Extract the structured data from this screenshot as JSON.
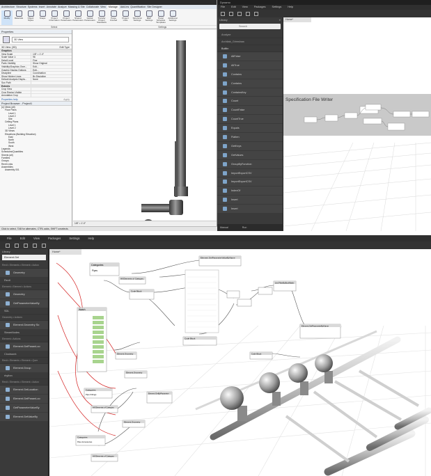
{
  "revit": {
    "title": "",
    "tabs": [
      "Architecture",
      "Structure",
      "Systems",
      "Insert",
      "Annotate",
      "Analyze",
      "Massing & Site",
      "Collaborate",
      "View",
      "Manage",
      "Add-Ins",
      "Quantification",
      "Site Designer"
    ],
    "active_tab": "Manage",
    "ribbon_buttons": [
      "Modify",
      "Materials",
      "Object Styles",
      "Snaps",
      "Project Information",
      "Project Parameters",
      "Shared Parameters",
      "Global Parameters",
      "Transfer Project Standards",
      "Purge Unused",
      "Project Units",
      "Structural Settings",
      "MEP Settings",
      "Panel Schedule Templates",
      "Additional Settings"
    ],
    "panels": [
      "Select",
      "Settings"
    ],
    "properties": {
      "header": "Properties",
      "type_name": "3D View",
      "view_selector": "3D View: {3D}",
      "edit_type": "Edit Type",
      "groups": [
        {
          "name": "Graphics",
          "rows": [
            {
              "k": "View Scale",
              "v": "1/8\" = 1'-0\""
            },
            {
              "k": "Scale Value 1:",
              "v": "96"
            },
            {
              "k": "Detail Level",
              "v": "Fine"
            },
            {
              "k": "Parts Visibility",
              "v": "Show Original"
            },
            {
              "k": "Visibility/Graphics Over...",
              "v": "Edit..."
            },
            {
              "k": "Graphic Display Options",
              "v": "Edit..."
            },
            {
              "k": "Discipline",
              "v": "Coordination"
            },
            {
              "k": "Show Hidden Lines",
              "v": "By Discipline"
            },
            {
              "k": "Default Analysis Displa...",
              "v": "None"
            },
            {
              "k": "Sun Path",
              "v": ""
            }
          ]
        },
        {
          "name": "Extents",
          "rows": [
            {
              "k": "Crop View",
              "v": ""
            },
            {
              "k": "Crop Region Visible",
              "v": ""
            },
            {
              "k": "Annotation Crop",
              "v": ""
            }
          ]
        }
      ],
      "help_link": "Properties help",
      "apply": "Apply"
    },
    "browser": {
      "header": "Project Browser - Project1",
      "items": [
        "[o] Views (all)",
        "Floor Plans",
        "Level 1",
        "Level 2",
        "Site",
        "Ceiling Plans",
        "Level 1",
        "Level 2",
        "3D Views",
        "Elevations (Building Elevation)",
        "East",
        "North",
        "South",
        "West",
        "Legends",
        "Schedules/Quantities",
        "Sheets (all)",
        "Families",
        "Groups",
        "Revit Links",
        "Assemblies",
        "Assembly 001"
      ]
    },
    "view_bar": "1/8\" = 1'-0\"",
    "status": "Click to select, TAB for alternates, CTRL adds, SHIFT unselects."
  },
  "dynamo_small": {
    "title": "Dynamo",
    "menu": [
      "File",
      "Edit",
      "View",
      "Packages",
      "Settings",
      "Help"
    ],
    "library_label": "Library",
    "search_placeholder": "Search",
    "categories": [
      "Analyze",
      "Archilab_Grimshaw",
      "Builtin"
    ],
    "items": [
      "AllFalse",
      "AllTrue",
      "Contains",
      "Contains",
      "ContainsKey",
      "Count",
      "CountFalse",
      "CountTrue",
      "Equals",
      "Flatten",
      "GetKeys",
      "GetValues",
      "GroupByFunction",
      "ImportExportCSV",
      "ImportExportCSV",
      "IndexOf",
      "Insert",
      "Insert"
    ],
    "bottom": [
      "Manual",
      "Run"
    ],
    "workspace_tab": "Home*",
    "group_title": "Specification File Writer"
  },
  "dynamo_big": {
    "menu": [
      "File",
      "Edit",
      "View",
      "Packages",
      "Settings",
      "Help"
    ],
    "workspace_tab": "Home*",
    "library_label": "Library",
    "search_value": "Element.Get",
    "sections": [
      {
        "type": "path",
        "text": "Revit • Elements • Element • Action"
      },
      {
        "type": "item",
        "text": "Geometry"
      },
      {
        "type": "cat",
        "text": "Revit"
      },
      {
        "type": "path",
        "text": "Element • Element • Actions"
      },
      {
        "type": "item",
        "text": "Geometry"
      },
      {
        "type": "item",
        "text": "GetParameterValueBy"
      },
      {
        "type": "cat",
        "text": "SDL"
      },
      {
        "type": "path",
        "text": "Geometry • Actions"
      },
      {
        "type": "item",
        "text": "Element.Geometry So"
      },
      {
        "type": "cat",
        "text": "SteamNodes"
      },
      {
        "type": "path",
        "text": "Element • Actions"
      },
      {
        "type": "item",
        "text": "Element.GetParamLoo"
      },
      {
        "type": "cat",
        "text": "Clockwork"
      },
      {
        "type": "path",
        "text": "Revit • Elements • Element • Quer"
      },
      {
        "type": "item",
        "text": "Element.Group"
      },
      {
        "type": "cat",
        "text": "rhythm"
      },
      {
        "type": "path",
        "text": "Revit • Elements • Element • Action"
      },
      {
        "type": "item",
        "text": "Element.GetLocation"
      },
      {
        "type": "item",
        "text": "Element.GetParamLoo"
      },
      {
        "type": "item",
        "text": "GetParameterValueBy"
      },
      {
        "type": "item",
        "text": "Element.GetValueBy"
      }
    ],
    "nodes": {
      "categories_top": "Categories",
      "categories_top_value": "Pipes",
      "all_elements_1": "All Elements of Category",
      "code_block": "Code Block",
      "watch": "Watch",
      "element_geometry_1": "Element.Geometry",
      "element_geometry_2": "Element.Geometry",
      "element_geometry_3": "Element.Geometry",
      "get_param": "Element.GetParameterValueByName",
      "code_block_2": "Code Block",
      "list_filter": "List.FilterByBoolMask",
      "set_param": "Element.SetParameterByName",
      "categories_mid": "Categories",
      "categories_mid_value": "Pipe Fittings",
      "all_elements_2": "All Elements of Category",
      "categories_bot": "Categories",
      "categories_bot_value": "Pipe Accessories",
      "all_elements_3": "All Elements of Category",
      "element_by_parameter": "Element.GetByParameter",
      "code_block_3": "Code Block"
    }
  }
}
